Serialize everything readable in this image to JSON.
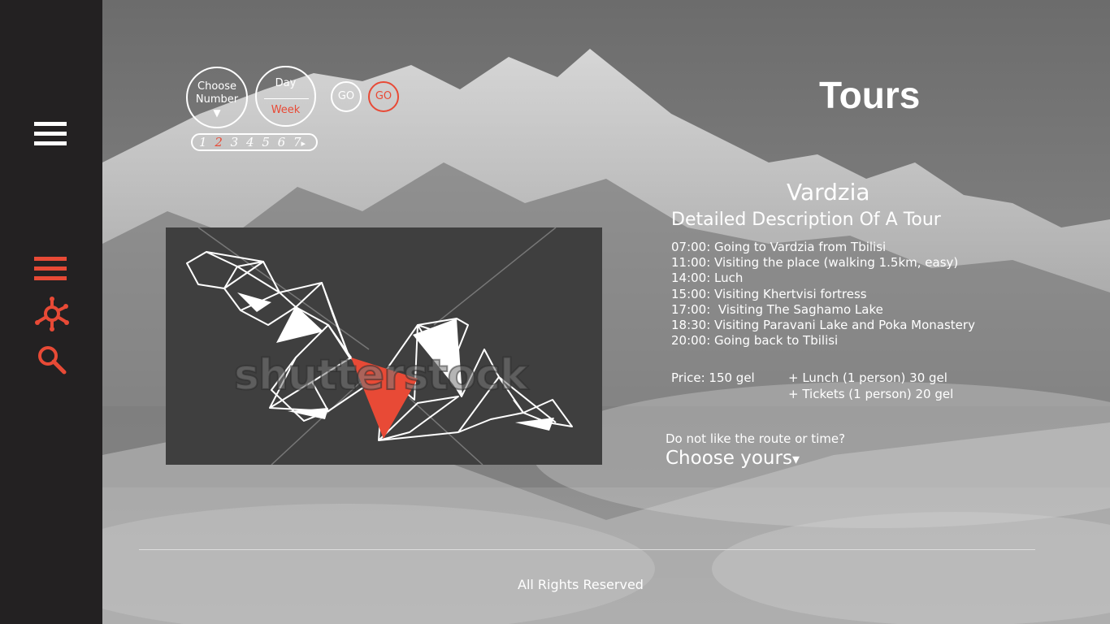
{
  "sidebar": {
    "icons": [
      "menu-icon",
      "list-icon",
      "network-icon",
      "search-icon"
    ],
    "accent_color": "#e84a36",
    "background": "#232122"
  },
  "controls": {
    "choose_number": {
      "line1": "Choose",
      "line2": "Number",
      "arrow": "▼"
    },
    "day_week": {
      "day": "Day",
      "week": "Week"
    },
    "go_buttons": [
      "GO",
      "GO"
    ],
    "pager": {
      "pages": [
        "1",
        "2",
        "3",
        "4",
        "5",
        "6",
        "7"
      ],
      "active": "2",
      "next": "▸"
    }
  },
  "map": {
    "watermark": "shutterstock"
  },
  "page": {
    "title": "Tours",
    "tour_name": "Vardzia",
    "description_title": "Detailed Description Of A Tour",
    "schedule": [
      "07:00: Going to Vardzia from Tbilisi",
      "11:00: Visiting the place (walking 1.5km, easy)",
      "14:00: Luch",
      "15:00: Visiting Khertvisi fortress",
      "17:00:  Visiting The Saghamo Lake",
      "18:30: Visiting Paravani Lake and Poka Monastery",
      "20:00: Going back to Tbilisi"
    ],
    "price": "Price: 150 gel",
    "extras": [
      "+ Lunch (1 person) 30 gel",
      "+ Tickets (1 person) 20 gel"
    ],
    "question": "Do not like the route or time?",
    "choose_yours": "Choose yours",
    "choose_arrow": "▾"
  },
  "footer": {
    "text": "All Rights Reserved"
  }
}
